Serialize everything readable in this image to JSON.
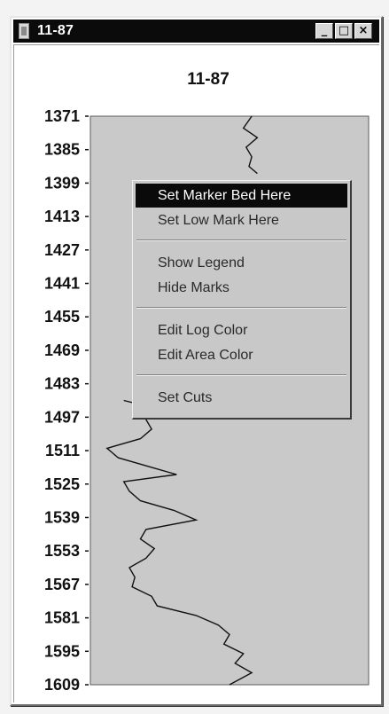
{
  "window": {
    "title": "11-87",
    "minimize_symbol": "_",
    "maximize_symbol": "□",
    "close_symbol": "×"
  },
  "chart_data": {
    "type": "line",
    "title": "11-87",
    "xlabel": "",
    "ylabel": "",
    "y_axis_inverted": true,
    "ylim": [
      1371,
      1609
    ],
    "y_ticks": [
      "1371",
      "1385",
      "1399",
      "1413",
      "1427",
      "1441",
      "1455",
      "1469",
      "1483",
      "1497",
      "1511",
      "1525",
      "1539",
      "1553",
      "1567",
      "1581",
      "1595",
      "1609"
    ],
    "series": [
      {
        "points": [
          {
            "depth": 1371,
            "value": 0.58
          },
          {
            "depth": 1376,
            "value": 0.55
          },
          {
            "depth": 1380,
            "value": 0.6
          },
          {
            "depth": 1384,
            "value": 0.56
          },
          {
            "depth": 1388,
            "value": 0.58
          },
          {
            "depth": 1392,
            "value": 0.57
          },
          {
            "depth": 1395,
            "value": 0.6
          },
          {
            "depth": 1490,
            "value": 0.12
          },
          {
            "depth": 1494,
            "value": 0.26
          },
          {
            "depth": 1498,
            "value": 0.2
          },
          {
            "depth": 1502,
            "value": 0.22
          },
          {
            "depth": 1506,
            "value": 0.18
          },
          {
            "depth": 1510,
            "value": 0.06
          },
          {
            "depth": 1514,
            "value": 0.1
          },
          {
            "depth": 1518,
            "value": 0.22
          },
          {
            "depth": 1521,
            "value": 0.31
          },
          {
            "depth": 1524,
            "value": 0.12
          },
          {
            "depth": 1528,
            "value": 0.14
          },
          {
            "depth": 1532,
            "value": 0.18
          },
          {
            "depth": 1536,
            "value": 0.3
          },
          {
            "depth": 1540,
            "value": 0.38
          },
          {
            "depth": 1544,
            "value": 0.2
          },
          {
            "depth": 1548,
            "value": 0.18
          },
          {
            "depth": 1552,
            "value": 0.23
          },
          {
            "depth": 1556,
            "value": 0.2
          },
          {
            "depth": 1560,
            "value": 0.14
          },
          {
            "depth": 1564,
            "value": 0.16
          },
          {
            "depth": 1568,
            "value": 0.15
          },
          {
            "depth": 1572,
            "value": 0.22
          },
          {
            "depth": 1576,
            "value": 0.24
          },
          {
            "depth": 1580,
            "value": 0.38
          },
          {
            "depth": 1584,
            "value": 0.46
          },
          {
            "depth": 1588,
            "value": 0.5
          },
          {
            "depth": 1592,
            "value": 0.48
          },
          {
            "depth": 1596,
            "value": 0.55
          },
          {
            "depth": 1600,
            "value": 0.52
          },
          {
            "depth": 1604,
            "value": 0.58
          },
          {
            "depth": 1609,
            "value": 0.5
          }
        ]
      }
    ],
    "fill_color": "#c9c9c9",
    "line_color": "#111111"
  },
  "context_menu": {
    "items": [
      {
        "label": "Set Marker Bed Here",
        "active": true
      },
      {
        "label": "Set Low Mark Here",
        "active": false
      },
      {
        "label": "Show Legend",
        "active": false
      },
      {
        "label": "Hide Marks",
        "active": false
      },
      {
        "label": "Edit Log Color",
        "active": false
      },
      {
        "label": "Edit Area Color",
        "active": false
      },
      {
        "label": "Set Cuts",
        "active": false
      }
    ]
  }
}
